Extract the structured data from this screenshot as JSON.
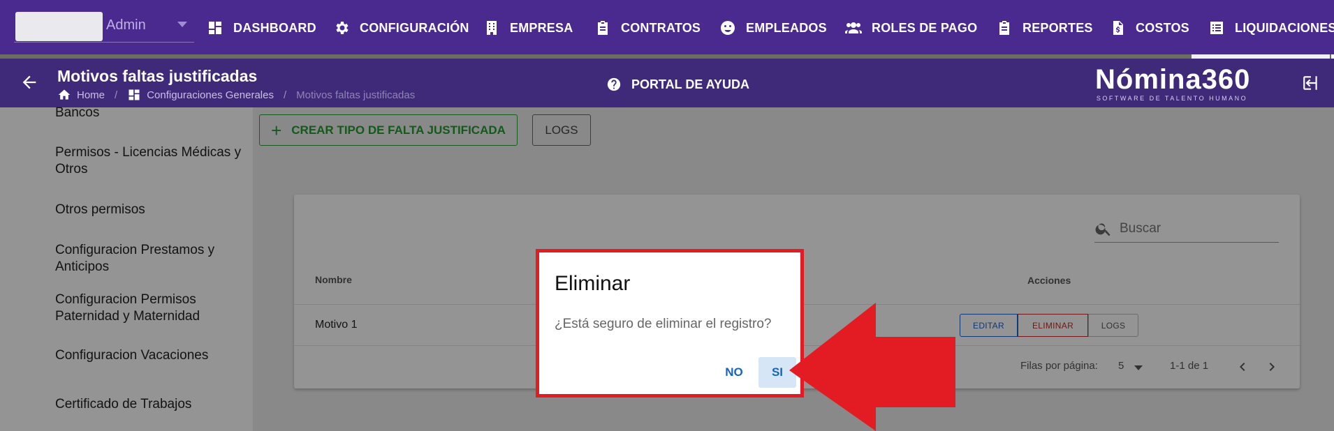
{
  "user": {
    "name": "Admin"
  },
  "nav": {
    "items": [
      {
        "label": "DASHBOARD",
        "icon": "dashboard-icon"
      },
      {
        "label": "CONFIGURACIÓN",
        "icon": "gear-icon"
      },
      {
        "label": "EMPRESA",
        "icon": "building-icon"
      },
      {
        "label": "CONTRATOS",
        "icon": "clipboard-icon"
      },
      {
        "label": "EMPLEADOS",
        "icon": "face-icon"
      },
      {
        "label": "ROLES DE PAGO",
        "icon": "people-icon"
      },
      {
        "label": "REPORTES",
        "icon": "clipboard-icon"
      },
      {
        "label": "COSTOS",
        "icon": "file-dollar-icon"
      },
      {
        "label": "LIQUIDACIONES",
        "icon": "list-icon"
      }
    ]
  },
  "header": {
    "title": "Motivos faltas justificadas",
    "breadcrumb": {
      "home": "Home",
      "section": "Configuraciones Generales",
      "current": "Motivos faltas justificadas"
    },
    "help": "PORTAL DE AYUDA",
    "brand_name": "Nómina360",
    "brand_sub": "SOFTWARE DE TALENTO HUMANO"
  },
  "sidebar": {
    "items": [
      {
        "label": "Bancos"
      },
      {
        "label": "Permisos - Licencias Médicas y Otros"
      },
      {
        "label": "Otros permisos"
      },
      {
        "label": "Configuracion Prestamos y Anticipos"
      },
      {
        "label": "Configuracion Permisos Paternidad y Maternidad"
      },
      {
        "label": "Configuracion Vacaciones"
      },
      {
        "label": "Certificado de Trabajos"
      }
    ]
  },
  "toolbar": {
    "create_label": "CREAR TIPO DE FALTA JUSTIFICADA",
    "logs_label": "LOGS"
  },
  "table": {
    "search_placeholder": "Buscar",
    "headers": {
      "name": "Nombre",
      "actions": "Acciones"
    },
    "rows": [
      {
        "name": "Motivo 1",
        "edit": "EDITAR",
        "delete": "ELIMINAR",
        "logs": "LOGS"
      }
    ],
    "pagination": {
      "rows_label": "Filas por página:",
      "rows_value": "5",
      "range": "1-1 de 1"
    }
  },
  "dialog": {
    "title": "Eliminar",
    "message": "¿Está seguro de eliminar el registro?",
    "no_label": "NO",
    "yes_label": "SI"
  },
  "colors": {
    "nav_bg": "#4b2a8f",
    "subhead_bg": "#3f2a7a",
    "create_green": "#249a30",
    "annotation_red": "#e31b23",
    "dialog_button_blue": "#1565c0"
  }
}
